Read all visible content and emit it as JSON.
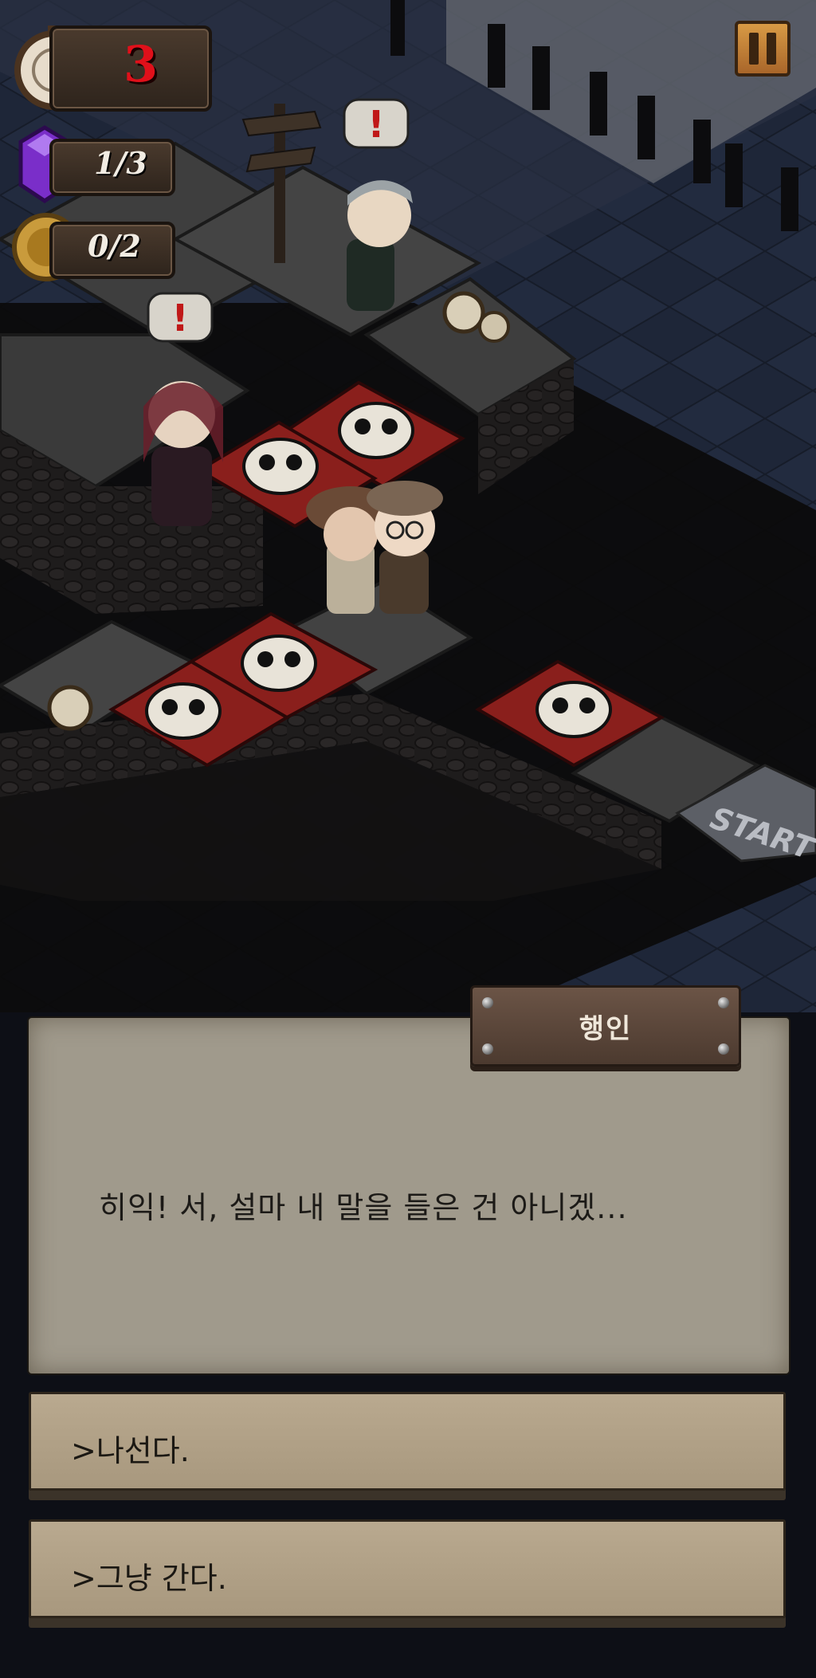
{
  "hud": {
    "turns_remaining": "3",
    "gems": "1/3",
    "coins": "0/2"
  },
  "board": {
    "start_label": "START",
    "alert_mark": "!"
  },
  "dialog": {
    "speaker": "행인",
    "text": "히익! 서, 설마 내 말을 들은 건 아니겠...",
    "choices": [
      {
        "label": ">나선다."
      },
      {
        "label": ">그냥 간다."
      }
    ]
  },
  "colors": {
    "danger_tile": "#8a1f1c",
    "parchment": "#a09a8c",
    "choice_bg": "#b3a388",
    "turn_number": "#e0101a"
  }
}
